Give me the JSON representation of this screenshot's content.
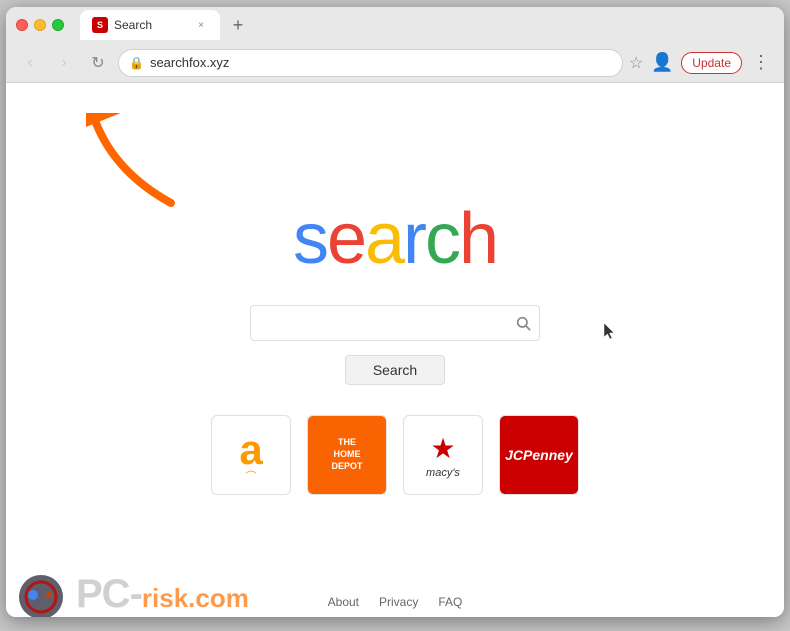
{
  "browser": {
    "tab": {
      "favicon_label": "S",
      "title": "Search",
      "close_label": "×"
    },
    "new_tab_label": "+",
    "nav": {
      "back_label": "‹",
      "forward_label": "›",
      "reload_label": "↻"
    },
    "address": {
      "url": "searchfox.xyz",
      "lock_icon": "🔒"
    },
    "star_label": "☆",
    "profile_label": "👤",
    "update_label": "Update",
    "menu_label": "⋮"
  },
  "page": {
    "logo": {
      "letters": [
        "s",
        "e",
        "a",
        "r",
        "c",
        "h"
      ],
      "colors": [
        "#4285f4",
        "#ea4335",
        "#fbbc05",
        "#4285f4",
        "#34a853",
        "#ea4335"
      ]
    },
    "search_placeholder": "",
    "search_button_label": "Search",
    "shortcuts": [
      {
        "name": "Amazon",
        "type": "amazon"
      },
      {
        "name": "Home Depot",
        "type": "homedepot"
      },
      {
        "name": "Macys",
        "type": "macys"
      },
      {
        "name": "JCPenney",
        "type": "jcpenney"
      }
    ],
    "footer_links": [
      {
        "label": "About"
      },
      {
        "label": "Privacy"
      },
      {
        "label": "FAQ"
      }
    ]
  }
}
